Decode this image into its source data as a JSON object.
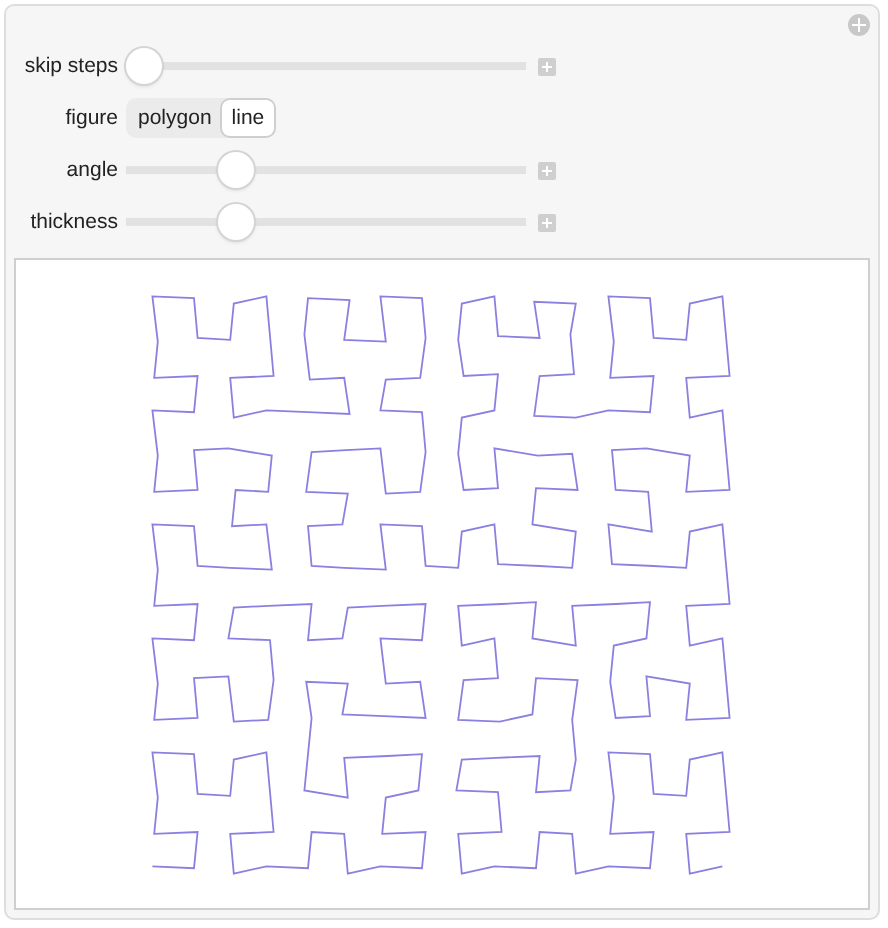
{
  "controls": [
    {
      "kind": "slider",
      "label": "skip steps",
      "level": 0
    },
    {
      "kind": "setter",
      "label": "figure",
      "options": [
        {
          "label": "polygon",
          "selected": false
        },
        {
          "label": "line",
          "selected": true
        }
      ]
    },
    {
      "kind": "slider",
      "label": "angle",
      "level": 0.25
    },
    {
      "kind": "slider",
      "label": "thickness",
      "level": 0.25
    }
  ]
}
